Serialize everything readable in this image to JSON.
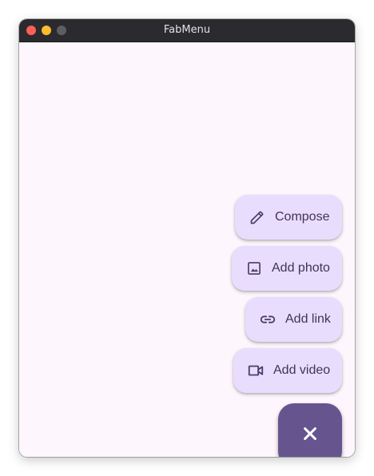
{
  "window": {
    "title": "FabMenu"
  },
  "fab_menu": {
    "items": [
      {
        "label": "Compose",
        "icon": "pencil-icon"
      },
      {
        "label": "Add photo",
        "icon": "image-icon"
      },
      {
        "label": "Add link",
        "icon": "link-icon"
      },
      {
        "label": "Add video",
        "icon": "videocam-icon"
      }
    ],
    "main_fab_icon": "close-icon"
  },
  "colors": {
    "titlebar": "#2b2a2e",
    "background": "#fdf7fd",
    "menu_item_container": "#e9ddfe",
    "menu_item_content": "#4a3d69",
    "main_fab_container": "#66548f",
    "main_fab_icon": "#ffffff"
  }
}
